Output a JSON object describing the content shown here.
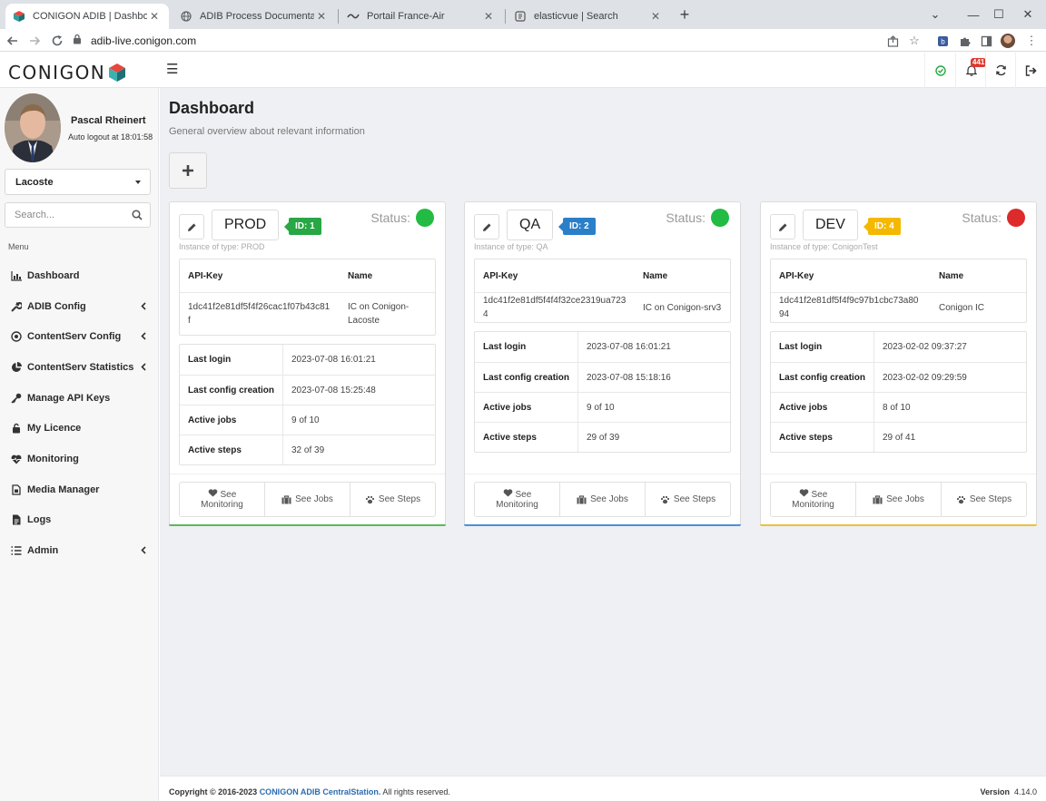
{
  "browser": {
    "tabs": [
      {
        "title": "CONIGON ADIB | Dashboard",
        "icon": "conigon-favicon",
        "active": true
      },
      {
        "title": "ADIB Process Documentation",
        "icon": "globe-icon",
        "active": false
      },
      {
        "title": "Portail France-Air",
        "icon": "france-air-favicon",
        "active": false
      },
      {
        "title": "elasticvue | Search",
        "icon": "elasticvue-favicon",
        "active": false
      }
    ],
    "url": "adib-live.conigon.com"
  },
  "header": {
    "logo_text": "CONIGON",
    "notification_count": "441"
  },
  "sidebar": {
    "user_name": "Pascal Rheinert",
    "auto_logout": "Auto logout at 18:01:58",
    "client_select": "Lacoste",
    "search_placeholder": "Search...",
    "menu_label": "Menu",
    "items": [
      {
        "label": "Dashboard",
        "icon": "chart-icon",
        "has_children": false
      },
      {
        "label": "ADIB Config",
        "icon": "wrench-icon",
        "has_children": true
      },
      {
        "label": "ContentServ Config",
        "icon": "target-icon",
        "has_children": true
      },
      {
        "label": "ContentServ Statistics",
        "icon": "pie-chart-icon",
        "has_children": true
      },
      {
        "label": "Manage API Keys",
        "icon": "key-icon",
        "has_children": false
      },
      {
        "label": "My Licence",
        "icon": "lock-icon",
        "has_children": false
      },
      {
        "label": "Monitoring",
        "icon": "heartbeat-icon",
        "has_children": false
      },
      {
        "label": "Media Manager",
        "icon": "file-icon",
        "has_children": false
      },
      {
        "label": "Logs",
        "icon": "document-icon",
        "has_children": false
      },
      {
        "label": "Admin",
        "icon": "list-icon",
        "has_children": true
      }
    ]
  },
  "main": {
    "title": "Dashboard",
    "subtitle": "General overview about relevant information",
    "status_label": "Status:",
    "api_key_header": "API-Key",
    "name_header": "Name",
    "labels": {
      "last_login": "Last login",
      "last_config": "Last config creation",
      "active_jobs": "Active jobs",
      "active_steps": "Active steps"
    },
    "buttons": {
      "monitoring_line1": "See",
      "monitoring_line2": "Monitoring",
      "jobs": "See Jobs",
      "steps": "See Steps"
    },
    "cards": [
      {
        "name": "PROD",
        "id_label": "ID: 1",
        "badge_color": "#28a745",
        "status_color": "#22bb44",
        "bottom_color": "#5cb85c",
        "instance": "Instance of type: PROD",
        "api_key": "1dc41f2e81df5f4f26cac1f07b43c81f",
        "api_name": "IC on Conigon-Lacoste",
        "last_login": "2023-07-08 16:01:21",
        "last_config": "2023-07-08 15:25:48",
        "active_jobs": "9 of 10",
        "active_steps": "32 of 39"
      },
      {
        "name": "QA",
        "id_label": "ID: 2",
        "badge_color": "#2a7fc9",
        "status_color": "#22bb44",
        "bottom_color": "#4a90d9",
        "instance": "Instance of type: QA",
        "api_key": "1dc41f2e81df5f4f4f32ce2319ua7234",
        "api_name": "IC on Conigon-srv3",
        "last_login": "2023-07-08 16:01:21",
        "last_config": "2023-07-08 15:18:16",
        "active_jobs": "9 of 10",
        "active_steps": "29 of 39"
      },
      {
        "name": "DEV",
        "id_label": "ID: 4",
        "badge_color": "#f5b800",
        "status_color": "#dd2a2a",
        "bottom_color": "#e8c33a",
        "instance": "Instance of type: ConigonTest",
        "api_key": "1dc41f2e81df5f4f9c97b1cbc73a8094",
        "api_name": "Conigon IC",
        "last_login": "2023-02-02 09:37:27",
        "last_config": "2023-02-02 09:29:59",
        "active_jobs": "8 of 10",
        "active_steps": "29 of 41"
      }
    ]
  },
  "footer": {
    "copyright_prefix": "Copyright © 2016-2023",
    "brand": "CONIGON ADIB CentralStation.",
    "rights": "All rights reserved.",
    "version_label": "Version",
    "version": "4.14.0"
  }
}
